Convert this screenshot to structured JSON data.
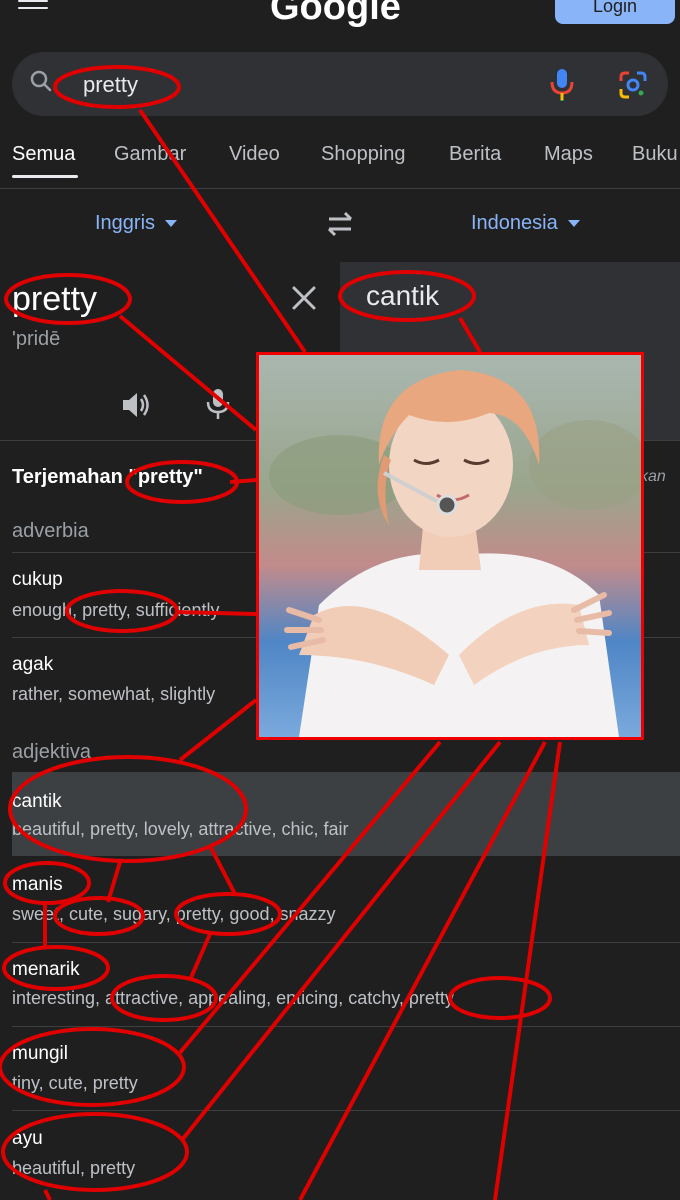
{
  "header": {
    "menu_icon": "hamburger-menu-icon",
    "logo": "Google",
    "login": "Login"
  },
  "search": {
    "query": "pretty",
    "icons": [
      "search-icon",
      "mic-icon",
      "google-lens-icon"
    ]
  },
  "tabs": [
    "Semua",
    "Gambar",
    "Video",
    "Shopping",
    "Berita",
    "Maps",
    "Buku"
  ],
  "translator": {
    "source_lang": "Inggris",
    "target_lang": "Indonesia",
    "source_word": "pretty",
    "source_phonetic": "'pridē",
    "target_word": "cantik"
  },
  "dictionary": {
    "heading_prefix": "Terjemahan",
    "heading_term": "\"pretty\"",
    "heading_right": "kan",
    "sections": [
      {
        "pos": "adverbia",
        "entries": [
          {
            "word": "cukup",
            "synonyms": "enough, pretty, sufficiently"
          },
          {
            "word": "agak",
            "synonyms": "rather, somewhat, slightly"
          }
        ]
      },
      {
        "pos": "adjektiva",
        "entries": [
          {
            "word": "cantik",
            "synonyms": "beautiful, pretty, lovely, attractive, chic, fair"
          },
          {
            "word": "manis",
            "synonyms": "sweet, cute, sugary, pretty, good, snazzy"
          },
          {
            "word": "menarik",
            "synonyms": "interesting, attractive, appealing, enticing, catchy, pretty"
          },
          {
            "word": "mungil",
            "synonyms": "tiny, cute, pretty"
          },
          {
            "word": "ayu",
            "synonyms": "beautiful, pretty"
          }
        ]
      }
    ]
  },
  "colors": {
    "annotation": "#e00000",
    "link": "#8ab4f8",
    "background": "#1f1f1f"
  }
}
